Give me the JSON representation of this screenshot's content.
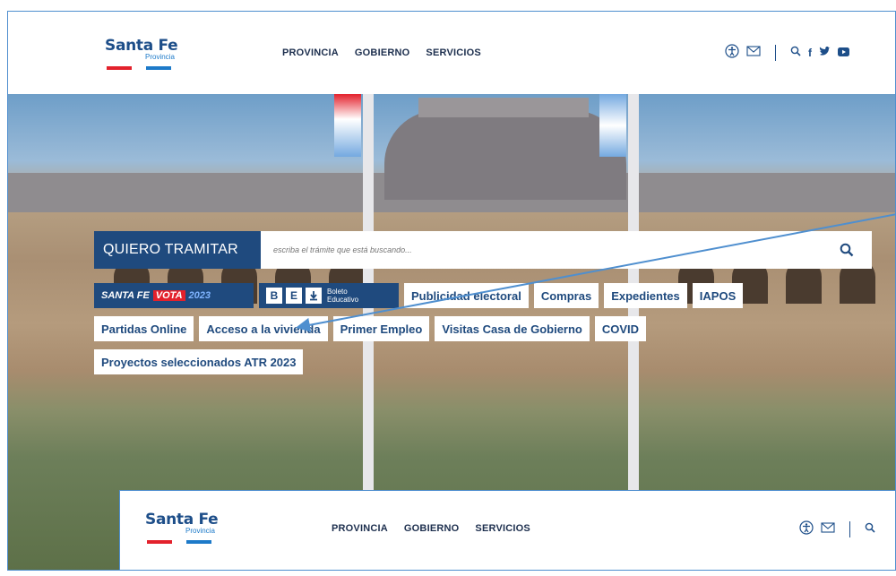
{
  "header": {
    "logo_title": "Santa Fe",
    "logo_subtitle": "Provincia",
    "nav": [
      "PROVINCIA",
      "GOBIERNO",
      "SERVICIOS"
    ]
  },
  "search": {
    "label": "QUIERO TRAMITAR",
    "placeholder": "escriba el trámite que está buscando..."
  },
  "vota_chip": {
    "prefix": "SANTA FE",
    "word": "VOTA",
    "year": "2023"
  },
  "be_chip": {
    "b": "B",
    "e": "E",
    "line1": "Boleto",
    "line2": "Educativo"
  },
  "chips_row1": [
    "Publicidad electoral",
    "Compras",
    "Expedientes",
    "IAPOS"
  ],
  "chips_row2": [
    "Partidas Online",
    "Acceso a la vivienda",
    "Primer Empleo",
    "Visitas Casa de Gobierno",
    "COVID"
  ],
  "chips_row3": [
    "Proyectos seleccionados ATR 2023"
  ],
  "overlay": {
    "logo_title": "Santa Fe",
    "logo_subtitle": "Provincia",
    "nav": [
      "PROVINCIA",
      "GOBIERNO",
      "SERVICIOS"
    ]
  },
  "colors": {
    "brand_blue": "#1f4a7e",
    "brand_red": "#e3212c",
    "accent_blue": "#1d7ac9",
    "annotation": "#4f8fcf"
  },
  "icons": [
    "accessibility-icon",
    "mail-icon",
    "search-icon",
    "facebook-icon",
    "twitter-icon",
    "youtube-icon"
  ]
}
